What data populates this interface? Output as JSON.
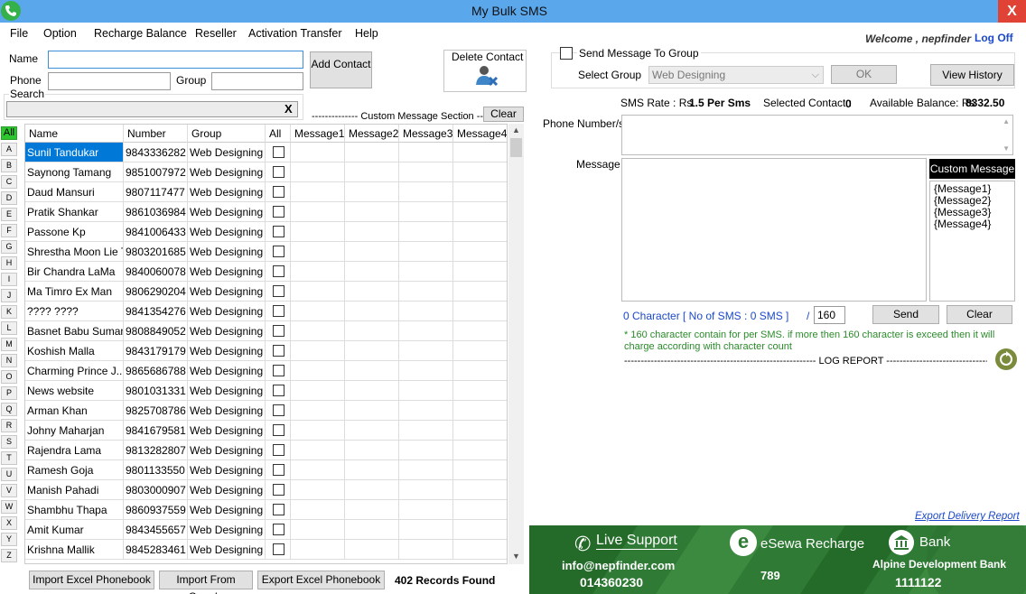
{
  "window": {
    "title": "My Bulk SMS",
    "close_label": "X"
  },
  "menu": [
    "File",
    "Option",
    "Recharge Balance",
    "Reseller",
    "Activation Transfer",
    "Help"
  ],
  "user": {
    "welcome": "Welcome , nepfinder",
    "logoff": "Log Off"
  },
  "contact_form": {
    "name_label": "Name",
    "phone_label": "Phone",
    "group_label": "Group",
    "search_label": "Search",
    "add_contact_label": "Add Contact",
    "delete_contact_label": "Delete Contact",
    "search_clear": "X"
  },
  "alphabet": [
    "All",
    "A",
    "B",
    "C",
    "D",
    "E",
    "F",
    "G",
    "H",
    "I",
    "J",
    "K",
    "L",
    "M",
    "N",
    "O",
    "P",
    "Q",
    "R",
    "S",
    "T",
    "U",
    "V",
    "W",
    "X",
    "Y",
    "Z"
  ],
  "grid": {
    "columns": [
      "Name",
      "Number",
      "Group",
      "All",
      "Message1",
      "Message2",
      "Message3",
      "Message4"
    ],
    "rows": [
      [
        "Sunil Tandukar",
        "9843336282",
        "Web Designing"
      ],
      [
        "Saynong Tamang",
        "9851007972",
        "Web Designing"
      ],
      [
        "Daud Mansuri",
        "9807117477",
        "Web Designing"
      ],
      [
        "Pratik Shankar",
        "9861036984",
        "Web Designing"
      ],
      [
        "Passone Kp",
        "9841006433",
        "Web Designing"
      ],
      [
        "Shrestha Moon Lie T",
        "9803201685",
        "Web Designing"
      ],
      [
        "Bir Chandra LaMa",
        "9840060078",
        "Web Designing"
      ],
      [
        "Ma Timro Ex Man",
        "9806290204",
        "Web Designing"
      ],
      [
        "???? ????",
        "9841354276",
        "Web Designing"
      ],
      [
        "Basnet Babu Suman",
        "9808849052",
        "Web Designing"
      ],
      [
        "Koshish Malla",
        "9843179179",
        "Web Designing"
      ],
      [
        "Charming Prince J...",
        "9865686788",
        "Web Designing"
      ],
      [
        "News website",
        "9801031331",
        "Web Designing"
      ],
      [
        "Arman Khan",
        "9825708786",
        "Web Designing"
      ],
      [
        "Johny Maharjan",
        "9841679581",
        "Web Designing"
      ],
      [
        "Rajendra Lama",
        "9813282807",
        "Web Designing"
      ],
      [
        "Ramesh Goja",
        "9801133550",
        "Web Designing"
      ],
      [
        "Manish Pahadi",
        "9803000907",
        "Web Designing"
      ],
      [
        "Shambhu Thapa",
        "9860937559",
        "Web Designing"
      ],
      [
        "Amit Kumar",
        "9843455657",
        "Web Designing"
      ],
      [
        "Krishna Mallik",
        "9845283461",
        "Web Designing"
      ]
    ]
  },
  "custom_section": {
    "label": "-------------- Custom Message Section --",
    "clear_label": "Clear"
  },
  "bottom": {
    "import_excel": "Import Excel Phonebook",
    "import_google": "Import From Google",
    "export_excel": "Export Excel Phonebook",
    "records": "402 Records Found"
  },
  "group_panel": {
    "send_to_group_label": "Send Message To Group",
    "select_group_label": "Select Group",
    "selected_group": "Web Designing",
    "ok_label": "OK",
    "view_history_label": "View History"
  },
  "sms_info": {
    "rate_label": "SMS Rate : Rs",
    "rate_value": "1.5 Per Sms",
    "selected_label": "Selected Contact :",
    "selected_value": "0",
    "balance_label": "Available Balance: Rs",
    "balance_value": "8332.50"
  },
  "compose": {
    "phone_label": "Phone Number/s",
    "message_label": "Message",
    "custom_message_title": "Custom Message",
    "custom_messages": [
      "{Message1}",
      "{Message2}",
      "{Message3}",
      "{Message4}"
    ],
    "char_count": "0 Character",
    "sms_count": "[ No of SMS : 0 SMS ]",
    "slash": "/",
    "limit": "160",
    "send_label": "Send",
    "clear_label": "Clear",
    "note": "* 160 character contain  for per SMS. if more then 160  character is exceed  then it will charge according with character count",
    "log_report": "---------------------------------------------------------- LOG REPORT ------------------------------------------------------------",
    "export_delivery": "Export Delivery Report"
  },
  "banner": {
    "live_support": "Live Support",
    "email": "info@nepfinder.com",
    "phone": "014360230",
    "esewa": "eSewa Recharge",
    "esewa_number": "789",
    "bank_title": "Bank",
    "bank_name": "Alpine Development Bank",
    "bank_number": "1111122"
  },
  "colors": {
    "titlebar": "#5aa7ec",
    "selection": "#0078d7",
    "link": "#1b49c9",
    "note_green": "#2a8a2a",
    "banner_green": "#2e7d32"
  }
}
